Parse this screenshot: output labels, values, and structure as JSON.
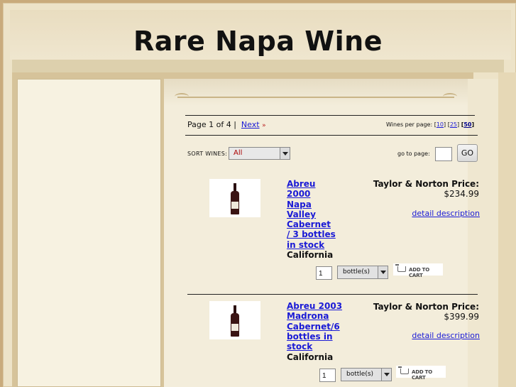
{
  "site": {
    "title": "Rare Napa Wine"
  },
  "pager": {
    "page_text": "Page 1 of 4 |",
    "next_label": "Next",
    "next_arrow": "»",
    "per_page_label": "Wines per page:",
    "per_page_options": [
      "10",
      "25",
      "50"
    ],
    "per_page_selected": "50"
  },
  "sort": {
    "label": "SORT WINES:",
    "selected": "All"
  },
  "goto": {
    "label": "go to page:",
    "value": "",
    "button": "GO"
  },
  "products": [
    {
      "name": "Abreu 2000 Napa Valley Cabernet / 3 bottles in stock",
      "name_lines": [
        "Abreu",
        "2000",
        "Napa",
        "Valley",
        "Cabernet",
        "/ 3 bottles",
        "in stock"
      ],
      "region": "California",
      "price_label": "Taylor & Norton Price:",
      "price": "$234.99",
      "detail_label": "detail description",
      "qty": "1",
      "unit": "bottle(s)",
      "cart_label": "ADD TO CART",
      "thumb_icon": "wine-bottle-icon"
    },
    {
      "name": "Abreu 2003 Madrona Cabernet/6 bottles in stock",
      "name_lines": [
        "Abreu 2003",
        "Madrona",
        "Cabernet/6",
        "bottles in",
        "stock"
      ],
      "region": "California",
      "price_label": "Taylor & Norton Price:",
      "price": "$399.99",
      "detail_label": "detail description",
      "qty": "1",
      "unit": "bottle(s)",
      "cart_label": "ADD TO CART",
      "thumb_icon": "wine-bottle-icon"
    }
  ]
}
